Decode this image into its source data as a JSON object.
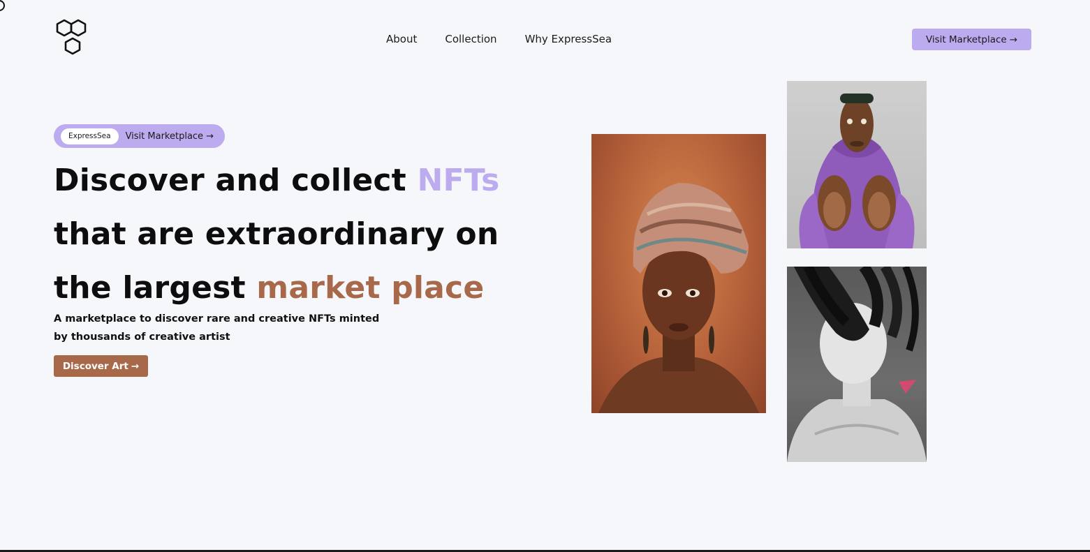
{
  "nav": {
    "items": [
      {
        "label": "About"
      },
      {
        "label": "Collection"
      },
      {
        "label": "Why ExpressSea"
      }
    ],
    "cta_label": "Visit Marketplace",
    "cta_arrow": "→"
  },
  "hero": {
    "pill_tag": "ExpressSea",
    "pill_link": "Visit Marketplace",
    "pill_arrow": "→",
    "headline": {
      "line1_a": "Discover and collect ",
      "line1_b": "NFTs",
      "line2": "that are extraordinary on",
      "line3_a": "the largest ",
      "line3_b": "market place"
    },
    "subtext": "A marketplace to discover rare and creative NFTs minted by thousands of creative artist",
    "discover_label": "Discover Art",
    "discover_arrow": "→"
  },
  "colors": {
    "background": "#f6f7fb",
    "accent_purple": "#bcabee",
    "accent_brown": "#a8694a"
  },
  "icons": {
    "logo": "hexagon-cluster-logo-icon"
  }
}
